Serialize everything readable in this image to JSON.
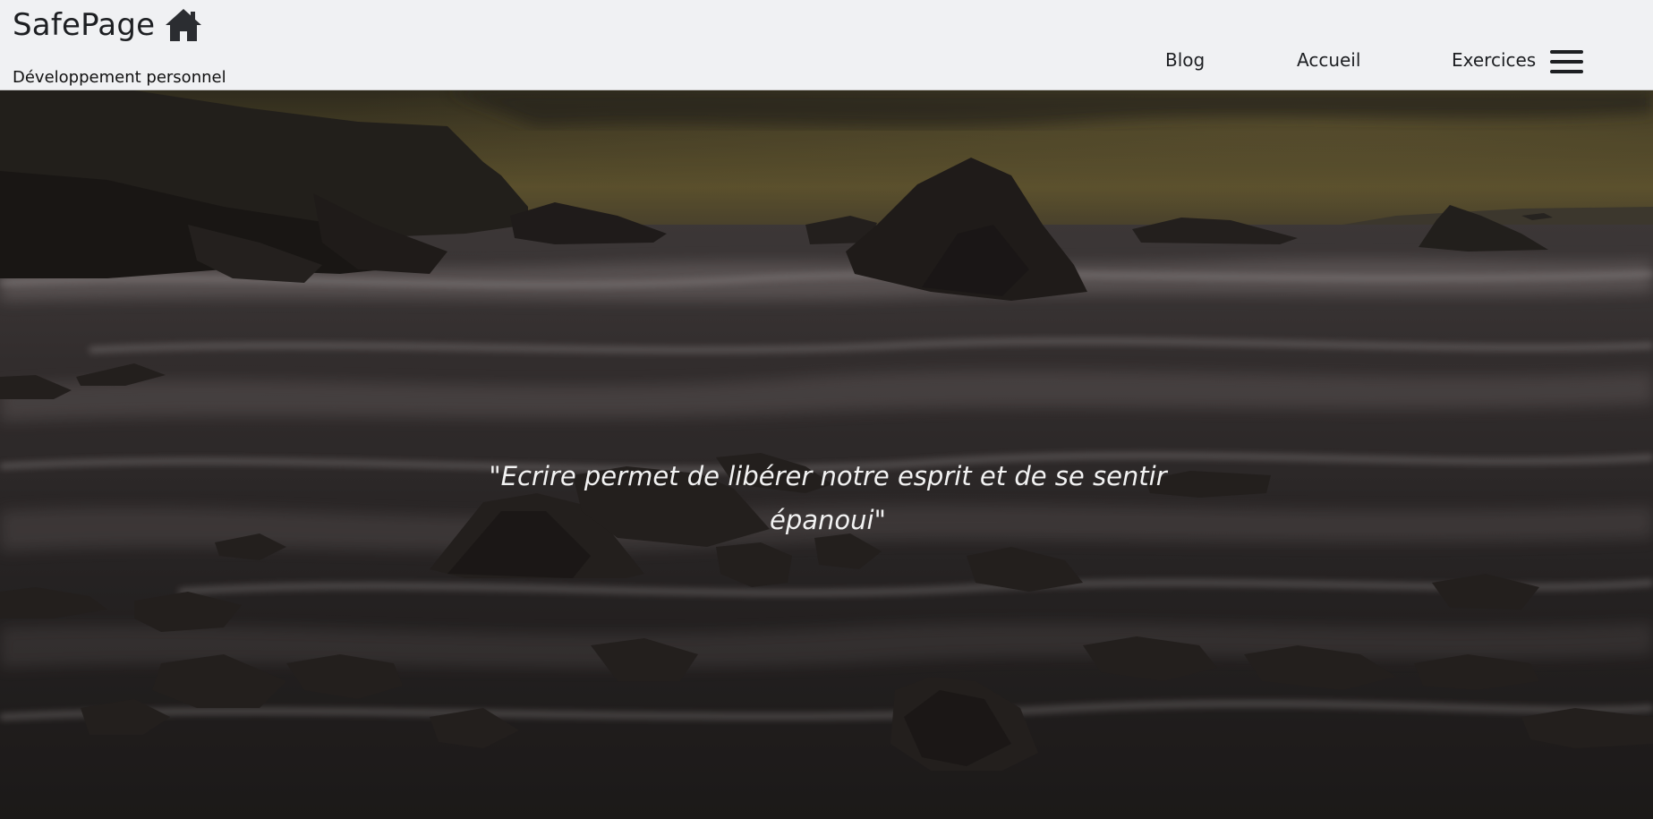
{
  "header": {
    "brand": "SafePage",
    "brand_icon": "home-icon",
    "tagline": "Développement personnel",
    "background": "#f0f1f3"
  },
  "nav": {
    "items": [
      {
        "label": "Blog"
      },
      {
        "label": "Accueil"
      },
      {
        "label": "Exercices"
      }
    ],
    "menu_icon": "hamburger-menu-icon"
  },
  "hero": {
    "quote": "\"Ecrire permet de libérer notre esprit et de se sentir épanoui\"",
    "image": "dark seascape with rocks and waves"
  }
}
